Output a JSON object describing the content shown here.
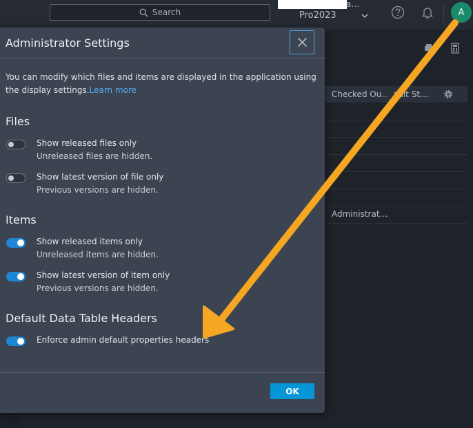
{
  "topbar": {
    "search_placeholder": "Search",
    "project_ellipsis": "a…",
    "project_name": "Pro2023",
    "avatar_initial": "A"
  },
  "background_table": {
    "headers": [
      "Checked Ou…",
      "ault St…"
    ],
    "admin_cell": "Administrat…"
  },
  "dialog": {
    "title": "Administrator Settings",
    "intro_text": "You can modify which files and items are displayed in the application using the display settings.",
    "learn_more": "Learn more",
    "sections": {
      "files": {
        "title": "Files",
        "options": [
          {
            "label": "Show released files only",
            "sub": "Unreleased files are hidden.",
            "enabled": false
          },
          {
            "label": "Show latest version of file only",
            "sub": "Previous versions are hidden.",
            "enabled": false
          }
        ]
      },
      "items": {
        "title": "Items",
        "options": [
          {
            "label": "Show released items only",
            "sub": "Unreleased items are hidden.",
            "enabled": true
          },
          {
            "label": "Show latest version of item only",
            "sub": "Previous versions are hidden.",
            "enabled": true
          }
        ]
      },
      "headers": {
        "title": "Default Data Table Headers",
        "options": [
          {
            "label": "Enforce admin default properties headers",
            "enabled": true
          }
        ]
      }
    },
    "ok_label": "OK"
  },
  "colors": {
    "toggle_on": "#1e86d4",
    "accent_link": "#55aaf0",
    "ok_button": "#0696d7",
    "annotation_arrow": "#f5a623"
  },
  "icons": {
    "search": "search-icon",
    "help": "help-icon",
    "bell": "bell-icon",
    "close": "close-icon",
    "settings": "gear-icon",
    "chevron": "chevron-down-icon"
  }
}
